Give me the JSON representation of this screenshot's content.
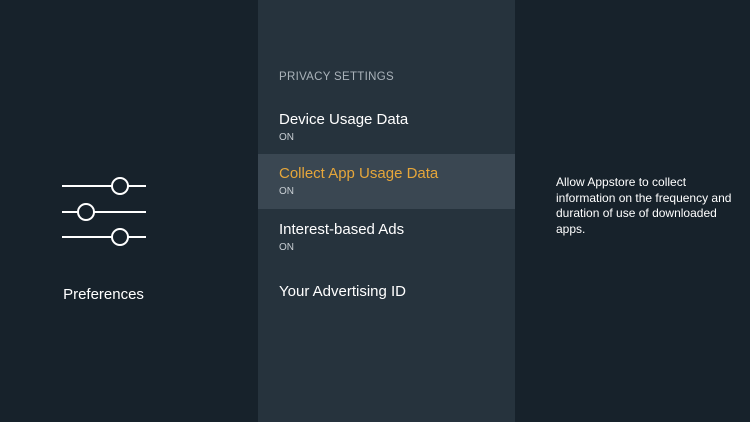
{
  "left_pane": {
    "icon": "sliders-icon",
    "label": "Preferences"
  },
  "middle_pane": {
    "section_header": "PRIVACY SETTINGS",
    "items": [
      {
        "title": "Device Usage Data",
        "value": "ON",
        "selected": false
      },
      {
        "title": "Collect App Usage Data",
        "value": "ON",
        "selected": true
      },
      {
        "title": "Interest-based Ads",
        "value": "ON",
        "selected": false
      },
      {
        "title": "Your Advertising ID",
        "value": "",
        "selected": false
      }
    ]
  },
  "right_pane": {
    "description": "Allow Appstore to collect information on the frequency and duration of use of downloaded apps."
  },
  "colors": {
    "accent": "#e6a63a",
    "background": "#17222b",
    "middle_background": "#26333d",
    "selected_background": "#3a4752"
  }
}
